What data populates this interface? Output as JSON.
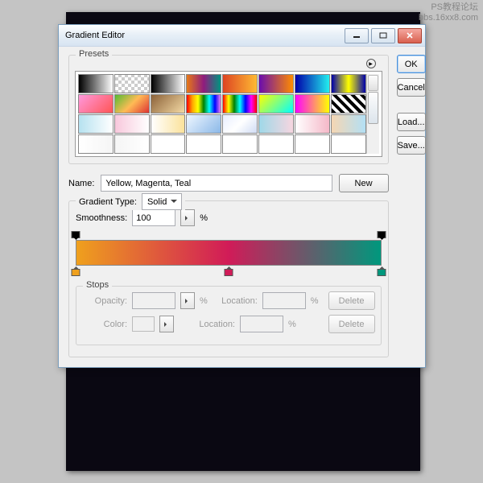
{
  "watermark": {
    "line1": "PS教程论坛",
    "line2": "bbs.16xx8.com"
  },
  "title": "Gradient Editor",
  "buttons": {
    "ok": "OK",
    "cancel": "Cancel",
    "load": "Load...",
    "save": "Save...",
    "new": "New",
    "delete": "Delete"
  },
  "labels": {
    "presets": "Presets",
    "name": "Name:",
    "gradType": "Gradient Type:",
    "smoothness": "Smoothness:",
    "pct": "%",
    "stops": "Stops",
    "opacity": "Opacity:",
    "location": "Location:",
    "color": "Color:"
  },
  "values": {
    "name": "Yellow, Magenta, Teal",
    "gradType": "Solid",
    "smoothness": "100"
  },
  "swatches": [
    "linear-gradient(90deg,#000,#fff)",
    "repeating-conic-gradient(#ccc 0 25%,#fff 0 50%) 0/8px 8px",
    "linear-gradient(90deg,#000,#fff)",
    "linear-gradient(90deg,#E67817,#901C7E,#00947F)",
    "linear-gradient(90deg,#D42,#FB3)",
    "linear-gradient(90deg,#6A0DAD,#FF8C00)",
    "linear-gradient(90deg,#00A,#2EE)",
    "linear-gradient(90deg,#00A,#FF0,#00A)",
    "linear-gradient(135deg,#F9D,#F55)",
    "linear-gradient(135deg,#5B3,#FB5,#D33)",
    "linear-gradient(135deg,#8C6239,#F3D9A4)",
    "linear-gradient(90deg,red,orange,yellow,green,cyan,blue,violet)",
    "linear-gradient(90deg,red,yellow,green,cyan,blue,magenta,red)",
    "linear-gradient(135deg,#FF0,#0FF)",
    "linear-gradient(90deg,#F0F,#FF0)",
    "repeating-linear-gradient(45deg,#000 0 4px,#fff 4px 8px)",
    "linear-gradient(90deg,#B6E2F0,#fff)",
    "linear-gradient(90deg,#F8C8DC,#fff)",
    "linear-gradient(90deg,#fff,#FBE29B)",
    "linear-gradient(135deg,#EEF6FF,#8BB8E8)",
    "linear-gradient(135deg,#E8EEFF,#fff,#D0DCF5)",
    "linear-gradient(90deg,#9FD8E8,#F7D6E0)",
    "linear-gradient(90deg,#fff,#F5B8C8)",
    "linear-gradient(90deg,#F5D6B3,#B3E0F5)",
    "linear-gradient(90deg,#fff,#f5f5f5)",
    "linear-gradient(90deg,#f5f5f5,#fff)",
    "linear-gradient(90deg,#fff,#fff)",
    "linear-gradient(90deg,#fff,#fff)",
    "linear-gradient(90deg,#fff,#fff)",
    "linear-gradient(90deg,#fff,#fff)",
    "linear-gradient(90deg,#fff,#fff)",
    "linear-gradient(90deg,#fff,#fff)"
  ],
  "gradient": {
    "css": "linear-gradient(90deg,#EFA01D 0%,#D11B58 50%,#00987D 100%)",
    "opacityStops": [
      {
        "pos": 0
      },
      {
        "pos": 100
      }
    ],
    "colorStops": [
      {
        "pos": 0,
        "color": "#EFA01D"
      },
      {
        "pos": 50,
        "color": "#D11B58"
      },
      {
        "pos": 100,
        "color": "#00987D"
      }
    ]
  }
}
